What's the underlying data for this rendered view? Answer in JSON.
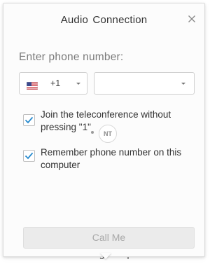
{
  "dialog": {
    "title": "Audio  Connection",
    "close_icon": "close-icon"
  },
  "form": {
    "prompt": "Enter phone number:",
    "country": {
      "flag_icon": "us-flag-icon",
      "code": "+1"
    },
    "phone_number": {
      "value": ""
    },
    "options": [
      {
        "label": "Join the teleconference without pressing \"1\"",
        "checked": true
      },
      {
        "label": "Remember phone number on this computer",
        "checked": true
      }
    ],
    "call_button_label": "Call Me"
  },
  "watermark": {
    "text": "NT"
  },
  "background": {
    "peek_text": "Call Using Computer"
  },
  "colors": {
    "checkmark": "#2a8ccf",
    "button_disabled_bg": "#ebebeb",
    "button_disabled_text": "#a8a8a8"
  }
}
